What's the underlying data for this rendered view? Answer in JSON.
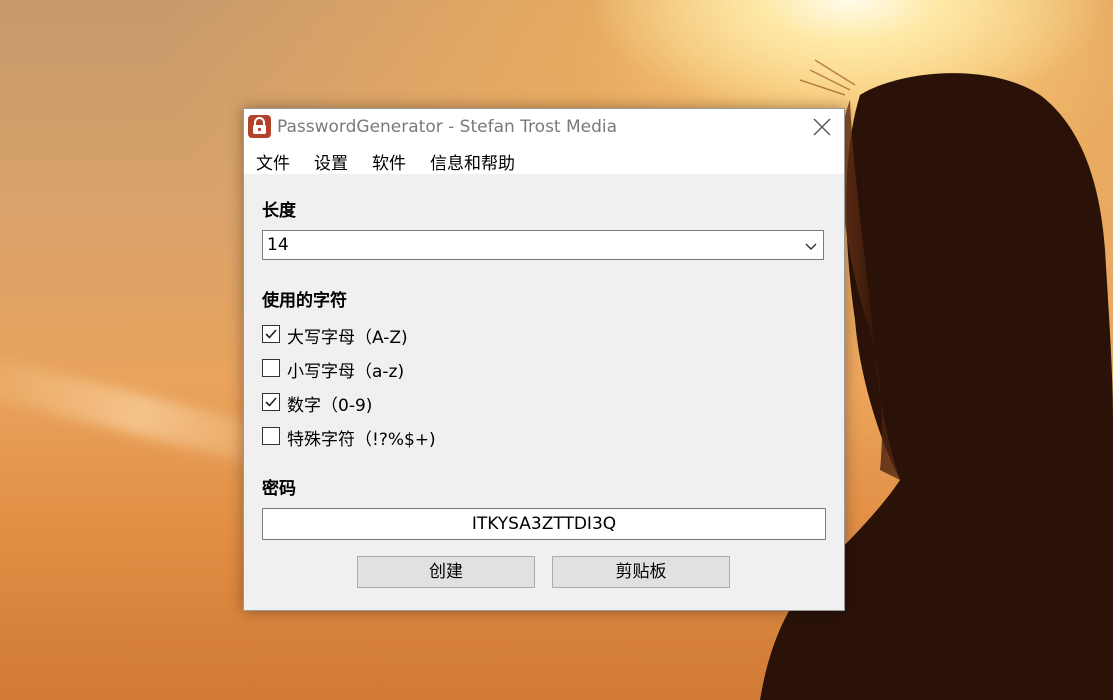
{
  "window": {
    "title": "PasswordGenerator - Stefan Trost Media"
  },
  "menu": {
    "items": [
      "文件",
      "设置",
      "软件",
      "信息和帮助"
    ]
  },
  "length": {
    "label": "长度",
    "value": "14"
  },
  "characters": {
    "label": "使用的字符",
    "options": [
      {
        "label": "大写字母（A-Z)",
        "checked": true
      },
      {
        "label": "小写字母（a-z)",
        "checked": false
      },
      {
        "label": "数字（0-9)",
        "checked": true
      },
      {
        "label": "特殊字符（!?%$+)",
        "checked": false
      }
    ]
  },
  "password": {
    "label": "密码",
    "value": "ITKYSA3ZTTDI3Q"
  },
  "buttons": {
    "create": "创建",
    "clipboard": "剪贴板"
  },
  "colors": {
    "app_icon": "#b3422b",
    "window_bg": "#f0f0f0",
    "button_bg": "#e1e1e1"
  },
  "icons": {
    "app": "lock-icon",
    "close": "close-icon",
    "dropdown": "chevron-down-icon",
    "check": "checkmark-icon"
  }
}
